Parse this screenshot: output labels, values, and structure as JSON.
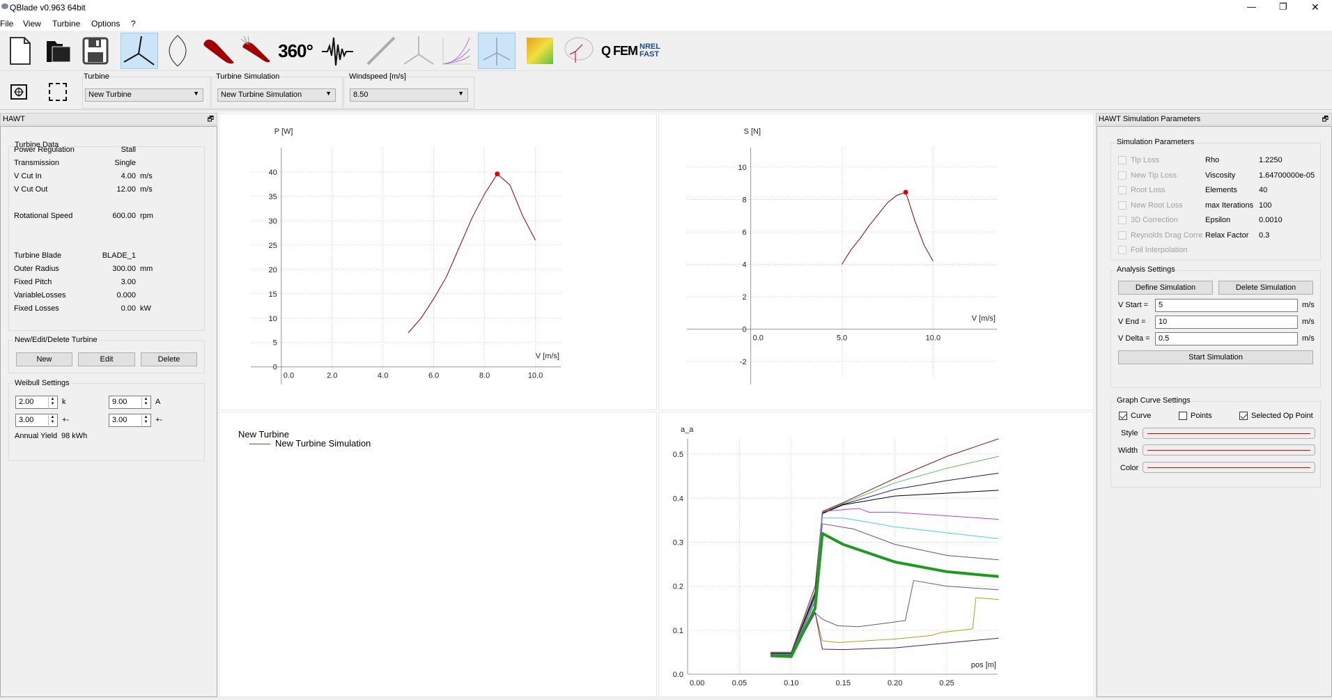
{
  "window": {
    "title": "QBlade v0.963 64bit",
    "min": "—",
    "max": "❐",
    "close": "✕"
  },
  "menu": [
    "File",
    "View",
    "Turbine",
    "Options",
    "?"
  ],
  "toolbar": {
    "icons": [
      "new-file-icon",
      "open-folder-icon",
      "save-icon",
      "hawt-turbine-icon",
      "vawt-blade-icon",
      "airfoil-icon",
      "polar-airfoil-icon",
      "360-extrapolation-icon",
      "turbulence-icon",
      "blade-icon",
      "turbine-icon",
      "curves-icon",
      "hawt-sim-icon",
      "windfield-icon",
      "rotor-icon",
      "qfem-icon",
      "nrel-fast-icon"
    ],
    "label_360": "360°",
    "label_qfem": "Q FEM",
    "label_nrel": "NREL FAST",
    "active": [
      "hawt-turbine-icon",
      "hawt-sim-icon"
    ]
  },
  "toolbar2": {
    "turbine_label": "Turbine",
    "turbine_value": "New Turbine",
    "sim_label": "Turbine Simulation",
    "sim_value": "New Turbine Simulation",
    "wind_label": "Windspeed [m/s]",
    "wind_value": "8.50"
  },
  "left": {
    "title": "HAWT",
    "turbine_data_title": "Turbine Data",
    "rows": [
      {
        "label": "Power Regulation",
        "value": "Stall",
        "unit": ""
      },
      {
        "label": "Transmission",
        "value": "Single",
        "unit": ""
      },
      {
        "label": "V Cut In",
        "value": "4.00",
        "unit": "m/s"
      },
      {
        "label": "V Cut Out",
        "value": "12.00",
        "unit": "m/s"
      },
      {
        "label": "Rotational Speed",
        "value": "600.00",
        "unit": "rpm"
      },
      {
        "label": "Turbine Blade",
        "value": "BLADE_1",
        "unit": ""
      },
      {
        "label": "Outer Radius",
        "value": "300.00",
        "unit": "mm"
      },
      {
        "label": "Fixed Pitch",
        "value": "3.00",
        "unit": ""
      },
      {
        "label": "VariableLosses",
        "value": "0.000",
        "unit": ""
      },
      {
        "label": "Fixed Losses",
        "value": "0.00",
        "unit": "kW"
      }
    ],
    "ned_title": "New/Edit/Delete Turbine",
    "new": "New",
    "edit": "Edit",
    "delete": "Delete",
    "weibull_title": "Weibull Settings",
    "k": "2.00",
    "k_label": "k",
    "A": "9.00",
    "A_label": "A",
    "k_pm": "3.00",
    "A_pm": "3.00",
    "pm": "+-",
    "annual_yield_label": "Annual Yield",
    "annual_yield": "98 kWh"
  },
  "right": {
    "title": "HAWT Simulation Parameters",
    "sim_title": "Simulation Parameters",
    "checks": [
      {
        "label": "Tip Loss",
        "checked": false
      },
      {
        "label": "New Tip Loss",
        "checked": false
      },
      {
        "label": "Root Loss",
        "checked": false
      },
      {
        "label": "New Root Loss",
        "checked": false
      },
      {
        "label": "3D Correction",
        "checked": false
      },
      {
        "label": "Reynolds Drag Corre",
        "checked": false
      },
      {
        "label": "Foil Interpolation",
        "checked": false
      }
    ],
    "params": [
      {
        "label": "Rho",
        "value": "1.2250"
      },
      {
        "label": "Viscosity",
        "value": "1.64700000e-05"
      },
      {
        "label": "Elements",
        "value": "40"
      },
      {
        "label": "max Iterations",
        "value": "100"
      },
      {
        "label": "Epsilon",
        "value": "0.0010"
      },
      {
        "label": "Relax Factor",
        "value": "0.3"
      }
    ],
    "analysis_title": "Analysis Settings",
    "define": "Define Simulation",
    "delete": "Delete Simulation",
    "vstart_label": "V Start =",
    "vstart": "5",
    "vend_label": "V End =",
    "vend": "10",
    "vdelta_label": "V Delta =",
    "vdelta": "0.5",
    "unit": "m/s",
    "start": "Start Simulation",
    "graph_title": "Graph Curve Settings",
    "curve": "Curve",
    "points": "Points",
    "selop": "Selected Op Point",
    "curve_checked": true,
    "points_checked": false,
    "selop_checked": true,
    "style": "Style",
    "width": "Width",
    "color": "Color",
    "curve_color": "#d00000"
  },
  "legend": {
    "turbine": "New Turbine",
    "simulation": "New Turbine Simulation",
    "color": "#c0392b"
  },
  "chart_data": [
    {
      "type": "line",
      "ylabel": "P [W]",
      "xlabel": "V [m/s]",
      "xlim": [
        -1.2,
        11
      ],
      "ylim": [
        -1.9,
        45
      ],
      "xticks": [
        0,
        2,
        4,
        6,
        8,
        10
      ],
      "yticks": [
        0,
        5,
        10,
        15,
        20,
        25,
        30,
        35,
        40
      ],
      "xtick_fmt": 1,
      "grid": true,
      "color": "#8b0000",
      "x": [
        5,
        5.5,
        6,
        6.5,
        7,
        7.5,
        8,
        8.5,
        9,
        9.5,
        10
      ],
      "y": [
        7,
        10,
        14,
        18.5,
        24.5,
        30.5,
        35.5,
        39.6,
        37.3,
        31,
        26
      ],
      "selected_point": [
        8.5,
        39.6
      ]
    },
    {
      "type": "line",
      "ylabel": "S [N]",
      "xlabel": "V [m/s]",
      "xlim": [
        -3.5,
        13.5
      ],
      "ylim": [
        -2.9,
        11.2
      ],
      "xticks": [
        0,
        5,
        10
      ],
      "yticks": [
        -2,
        0,
        2,
        4,
        6,
        8,
        10
      ],
      "xtick_fmt": 1,
      "grid": true,
      "color": "#8b0000",
      "x": [
        5,
        5.5,
        6,
        6.5,
        7,
        7.5,
        8,
        8.5,
        9,
        9.5,
        10
      ],
      "y": [
        4,
        4.9,
        5.6,
        6.4,
        7.1,
        7.8,
        8.25,
        8.45,
        6.7,
        5.2,
        4.2
      ],
      "selected_point": [
        8.5,
        8.45
      ]
    },
    {
      "type": "line",
      "ylabel": "a_a",
      "xlabel": "pos [m]",
      "xlim": [
        0,
        0.299
      ],
      "ylim": [
        0,
        0.535
      ],
      "xticks": [
        0,
        0.05,
        0.1,
        0.15,
        0.2,
        0.25
      ],
      "yticks": [
        0,
        0.1,
        0.2,
        0.3,
        0.4,
        0.5
      ],
      "xtick_fmt": 2,
      "ytick_fmt": 1,
      "grid": true,
      "series": [
        {
          "color": "#8b1a1a",
          "width": 1,
          "points": [
            [
              0.08,
              0.05
            ],
            [
              0.1,
              0.05
            ],
            [
              0.123,
              0.2
            ],
            [
              0.13,
              0.37
            ],
            [
              0.15,
              0.39
            ],
            [
              0.2,
              0.445
            ],
            [
              0.25,
              0.495
            ],
            [
              0.3,
              0.535
            ]
          ]
        },
        {
          "color": "#5cb85c",
          "width": 1,
          "points": [
            [
              0.08,
              0.048
            ],
            [
              0.1,
              0.048
            ],
            [
              0.123,
              0.19
            ],
            [
              0.13,
              0.368
            ],
            [
              0.15,
              0.388
            ],
            [
              0.2,
              0.435
            ],
            [
              0.25,
              0.468
            ],
            [
              0.3,
              0.495
            ]
          ]
        },
        {
          "color": "#1a1a6e",
          "width": 1,
          "points": [
            [
              0.08,
              0.047
            ],
            [
              0.1,
              0.047
            ],
            [
              0.123,
              0.185
            ],
            [
              0.13,
              0.366
            ],
            [
              0.15,
              0.386
            ],
            [
              0.2,
              0.42
            ],
            [
              0.25,
              0.44
            ],
            [
              0.3,
              0.457
            ]
          ]
        },
        {
          "color": "#000000",
          "width": 1,
          "points": [
            [
              0.08,
              0.046
            ],
            [
              0.1,
              0.046
            ],
            [
              0.123,
              0.18
            ],
            [
              0.13,
              0.365
            ],
            [
              0.15,
              0.385
            ],
            [
              0.2,
              0.405
            ],
            [
              0.3,
              0.418
            ]
          ]
        },
        {
          "color": "#c040c0",
          "width": 1,
          "points": [
            [
              0.08,
              0.045
            ],
            [
              0.1,
              0.045
            ],
            [
              0.123,
              0.175
            ],
            [
              0.13,
              0.37
            ],
            [
              0.165,
              0.377
            ],
            [
              0.175,
              0.368
            ],
            [
              0.2,
              0.368
            ],
            [
              0.3,
              0.352
            ]
          ]
        },
        {
          "color": "#40d0e0",
          "width": 1,
          "points": [
            [
              0.08,
              0.045
            ],
            [
              0.1,
              0.045
            ],
            [
              0.123,
              0.17
            ],
            [
              0.13,
              0.355
            ],
            [
              0.15,
              0.355
            ],
            [
              0.2,
              0.335
            ],
            [
              0.3,
              0.308
            ]
          ]
        },
        {
          "color": "#7a4a6a",
          "width": 1,
          "points": [
            [
              0.08,
              0.044
            ],
            [
              0.1,
              0.044
            ],
            [
              0.123,
              0.165
            ],
            [
              0.13,
              0.342
            ],
            [
              0.16,
              0.33
            ],
            [
              0.2,
              0.295
            ],
            [
              0.25,
              0.27
            ],
            [
              0.3,
              0.26
            ]
          ]
        },
        {
          "color": "#5a5a8a",
          "width": 1,
          "points": [
            [
              0.08,
              0.043
            ],
            [
              0.1,
              0.043
            ],
            [
              0.123,
              0.14
            ],
            [
              0.13,
              0.125
            ],
            [
              0.145,
              0.11
            ],
            [
              0.165,
              0.108
            ],
            [
              0.21,
              0.122
            ],
            [
              0.218,
              0.213
            ],
            [
              0.25,
              0.2
            ],
            [
              0.3,
              0.192
            ]
          ]
        },
        {
          "color": "#b0a020",
          "width": 1,
          "points": [
            [
              0.08,
              0.042
            ],
            [
              0.1,
              0.042
            ],
            [
              0.123,
              0.14
            ],
            [
              0.13,
              0.076
            ],
            [
              0.145,
              0.072
            ],
            [
              0.2,
              0.08
            ],
            [
              0.235,
              0.088
            ],
            [
              0.245,
              0.095
            ],
            [
              0.275,
              0.103
            ],
            [
              0.278,
              0.174
            ],
            [
              0.3,
              0.17
            ]
          ]
        },
        {
          "color": "#4a1a6a",
          "width": 1,
          "points": [
            [
              0.08,
              0.041
            ],
            [
              0.1,
              0.041
            ],
            [
              0.123,
              0.14
            ],
            [
              0.13,
              0.057
            ],
            [
              0.15,
              0.056
            ],
            [
              0.2,
              0.06
            ],
            [
              0.3,
              0.082
            ]
          ]
        },
        {
          "color": "#1e9a1e",
          "width": 4,
          "points": [
            [
              0.08,
              0.042
            ],
            [
              0.1,
              0.04
            ],
            [
              0.123,
              0.15
            ],
            [
              0.13,
              0.32
            ],
            [
              0.15,
              0.295
            ],
            [
              0.2,
              0.255
            ],
            [
              0.25,
              0.233
            ],
            [
              0.3,
              0.222
            ]
          ]
        }
      ]
    }
  ]
}
